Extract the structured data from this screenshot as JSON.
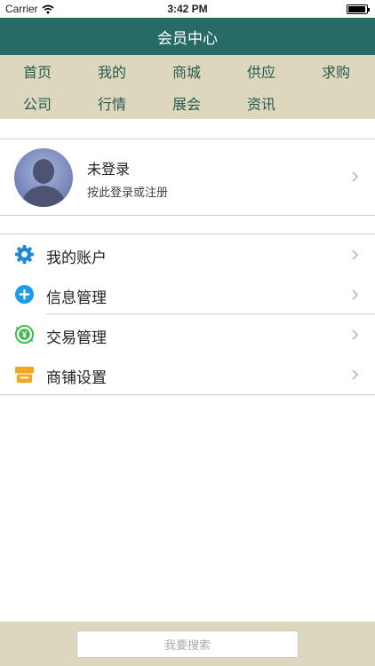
{
  "status_bar": {
    "carrier": "Carrier",
    "time": "3:42 PM"
  },
  "nav": {
    "title": "会员中心"
  },
  "categories": [
    "首页",
    "我的",
    "商城",
    "供应",
    "求购",
    "公司",
    "行情",
    "展会",
    "资讯"
  ],
  "login": {
    "title": "未登录",
    "subtitle": "按此登录或注册"
  },
  "menu": [
    {
      "label": "我的账户",
      "icon": "gear-icon"
    },
    {
      "label": "信息管理",
      "icon": "plus-circle-icon"
    },
    {
      "label": "交易管理",
      "icon": "yuan-exchange-icon"
    },
    {
      "label": "商铺设置",
      "icon": "shop-icon"
    }
  ],
  "search": {
    "placeholder": "我要搜索"
  },
  "colors": {
    "nav": "#276a66",
    "category_bg": "#ddd8bd",
    "category_text": "#27594f",
    "menu_blue": "#1e88d8",
    "menu_green": "#3cb94b",
    "menu_orange": "#f5a623"
  }
}
